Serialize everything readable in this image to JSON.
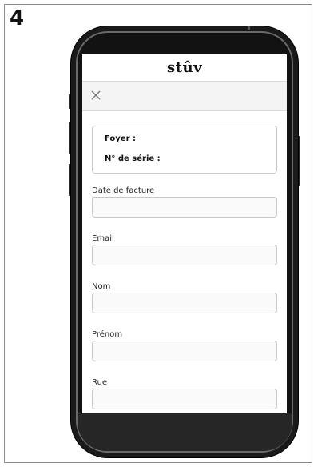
{
  "step": {
    "number": "4"
  },
  "app": {
    "logo_text": "stûv",
    "close_icon": "close-icon"
  },
  "product_info": {
    "foyer_label": "Foyer :",
    "serial_label": "N° de série :"
  },
  "form": {
    "fields": [
      {
        "label": "Date de facture",
        "value": ""
      },
      {
        "label": "Email",
        "value": ""
      },
      {
        "label": "Nom",
        "value": ""
      },
      {
        "label": "Prénom",
        "value": ""
      },
      {
        "label": "Rue",
        "value": ""
      }
    ]
  },
  "colors": {
    "phone_frame": "#1a1a1a",
    "bottom_bar": "#262626",
    "input_border": "#c7c7c7"
  }
}
